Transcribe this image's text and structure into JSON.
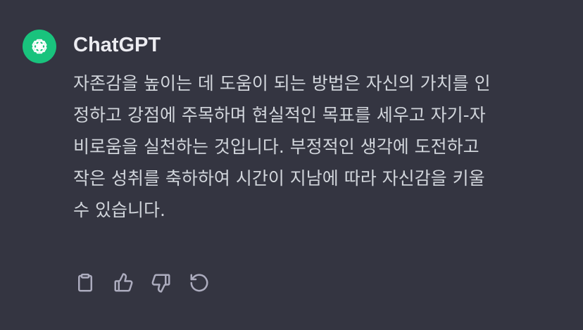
{
  "author": {
    "name": "ChatGPT",
    "avatar_icon": "openai-logo-icon",
    "avatar_color": "#19c37d"
  },
  "message": {
    "lines": [
      "자존감을 높이는 데 도움이 되는 방법은 자신의 가치를 인",
      "정하고 강점에 주목하며 현실적인 목표를 세우고 자기-자",
      "비로움을 실천하는 것입니다. 부정적인 생각에 도전하고",
      "작은 성취를 축하하여 시간이 지남에 따라 자신감을 키울",
      "수 있습니다."
    ]
  },
  "actions": [
    {
      "name": "copy",
      "icon": "clipboard-icon"
    },
    {
      "name": "thumbs-up",
      "icon": "thumbs-up-icon"
    },
    {
      "name": "thumbs-down",
      "icon": "thumbs-down-icon"
    },
    {
      "name": "regenerate",
      "icon": "regenerate-icon"
    }
  ],
  "colors": {
    "background": "#343541",
    "text": "#d1d5db",
    "author_text": "#ececf1",
    "icon": "#acacbe"
  }
}
